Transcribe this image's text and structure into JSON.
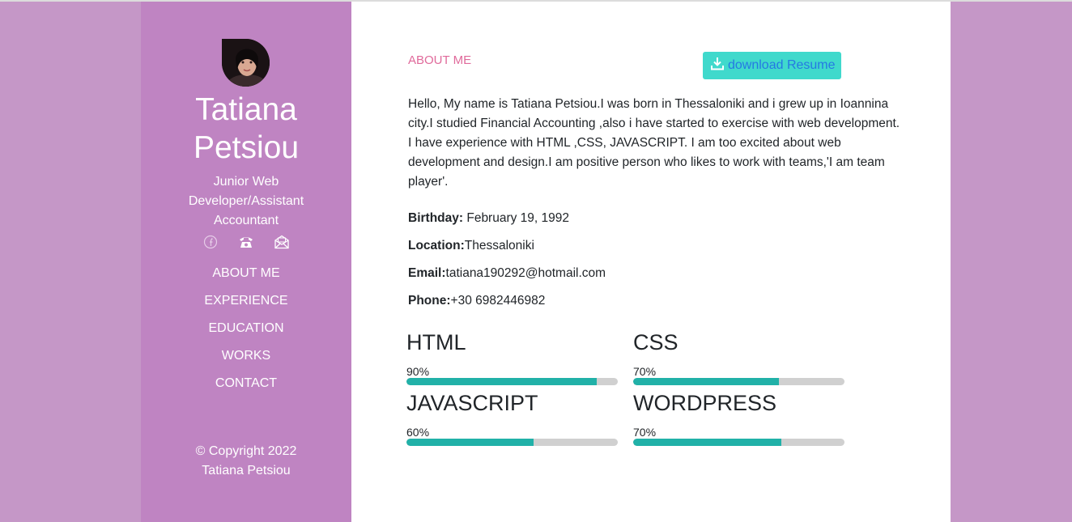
{
  "sidebar": {
    "name_line1": "Tatiana",
    "name_line2": "Petsiou",
    "role": "Junior Web Developer/Assistant Accountant",
    "social_icons": [
      "facebook-icon",
      "phone-icon",
      "email-icon"
    ],
    "nav": [
      {
        "label": "ABOUT ME"
      },
      {
        "label": "EXPERIENCE"
      },
      {
        "label": "EDUCATION"
      },
      {
        "label": "WORKS"
      },
      {
        "label": "CONTACT"
      }
    ],
    "copyright_line1": "© Copyright 2022",
    "copyright_line2": "Tatiana Petsiou"
  },
  "main": {
    "section_title": "ABOUT ME",
    "download_label": "download Resume",
    "bio": "Hello, My name is Tatiana Petsiou.I was born in Thessaloniki and i grew up in Ioannina city.I studied Financial Accounting ,also i have started to exercise with web development. I have experience with HTML ,CSS, JAVASCRIPT. I am too excited about web development and design.I am positive person who likes to work with teams,'I am team player'.",
    "info": {
      "birthday_label": "Birthday:",
      "birthday_value": " February 19, 1992",
      "location_label": "Location:",
      "location_value": "Thessaloniki",
      "email_label": "Email:",
      "email_value": "tatiana190292@hotmail.com",
      "phone_label": "Phone:",
      "phone_value": "+30 6982446982"
    },
    "skills": [
      {
        "name": "HTML",
        "percent_label": "90%",
        "level": 0.9
      },
      {
        "name": "CSS",
        "percent_label": "70%",
        "level": 0.69
      },
      {
        "name": "JAVASCRIPT",
        "percent_label": "60%",
        "level": 0.6
      },
      {
        "name": "WORDPRESS",
        "percent_label": "70%",
        "level": 0.7
      }
    ]
  },
  "colors": {
    "page_background": "#c597c7",
    "sidebar_background": "#bf84c2",
    "accent_title": "#e06a9b",
    "download_button": "#40d9cc",
    "download_text": "#2579e3",
    "bar_fill": "#21b1a8",
    "bar_track": "#d0d0d0"
  }
}
